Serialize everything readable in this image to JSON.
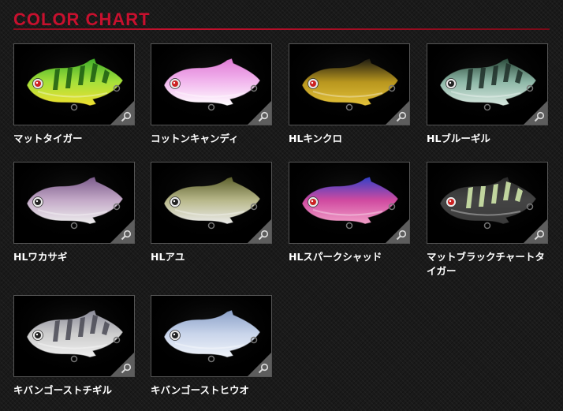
{
  "header": {
    "title": "COLOR CHART"
  },
  "items": [
    {
      "label": "マットタイガー",
      "colors": {
        "top": "#3fae2a",
        "mid": "#a6e03a",
        "belly": "#f0e030",
        "stripe": "#1b5c12",
        "eye": "#c22"
      }
    },
    {
      "label": "コットンキャンディ",
      "colors": {
        "top": "#e07ad6",
        "mid": "#f2b8ee",
        "belly": "#ffffff",
        "stripe": "none",
        "eye": "#c22"
      }
    },
    {
      "label": "HLキンクロ",
      "colors": {
        "top": "#1c1a12",
        "mid": "#b8961e",
        "belly": "#e4c23a",
        "stripe": "none",
        "eye": "#c22"
      }
    },
    {
      "label": "HLブルーギル",
      "colors": {
        "top": "#2a4a3a",
        "mid": "#8fb8a8",
        "belly": "#d8e8e0",
        "stripe": "#1e2e28",
        "eye": "#222"
      }
    },
    {
      "label": "HLワカサギ",
      "colors": {
        "top": "#7a5a8a",
        "mid": "#c4aac8",
        "belly": "#eeeeee",
        "stripe": "none",
        "eye": "#222"
      }
    },
    {
      "label": "HLアユ",
      "colors": {
        "top": "#5a5e2a",
        "mid": "#b8b88a",
        "belly": "#ececec",
        "stripe": "none",
        "eye": "#222"
      }
    },
    {
      "label": "HLスパークシャッド",
      "colors": {
        "top": "#3040c8",
        "mid": "#d04aa0",
        "belly": "#f2a0c8",
        "stripe": "none",
        "eye": "#c22"
      }
    },
    {
      "label": "マットブラックチャートタイガー",
      "colors": {
        "top": "#2a2a2a",
        "mid": "#444444",
        "belly": "#3a3a3a",
        "stripe": "#d8f0b0",
        "eye": "#c22"
      }
    },
    {
      "label": "キバンゴーストチギル",
      "colors": {
        "top": "#8a8a98",
        "mid": "#cccccc",
        "belly": "#f0f0f0",
        "stripe": "#4a4a55",
        "eye": "#222"
      }
    },
    {
      "label": "キバンゴーストヒウオ",
      "colors": {
        "top": "#8aa0c8",
        "mid": "#c8d4ea",
        "belly": "#f0f4fa",
        "stripe": "none",
        "eye": "#222"
      }
    }
  ]
}
